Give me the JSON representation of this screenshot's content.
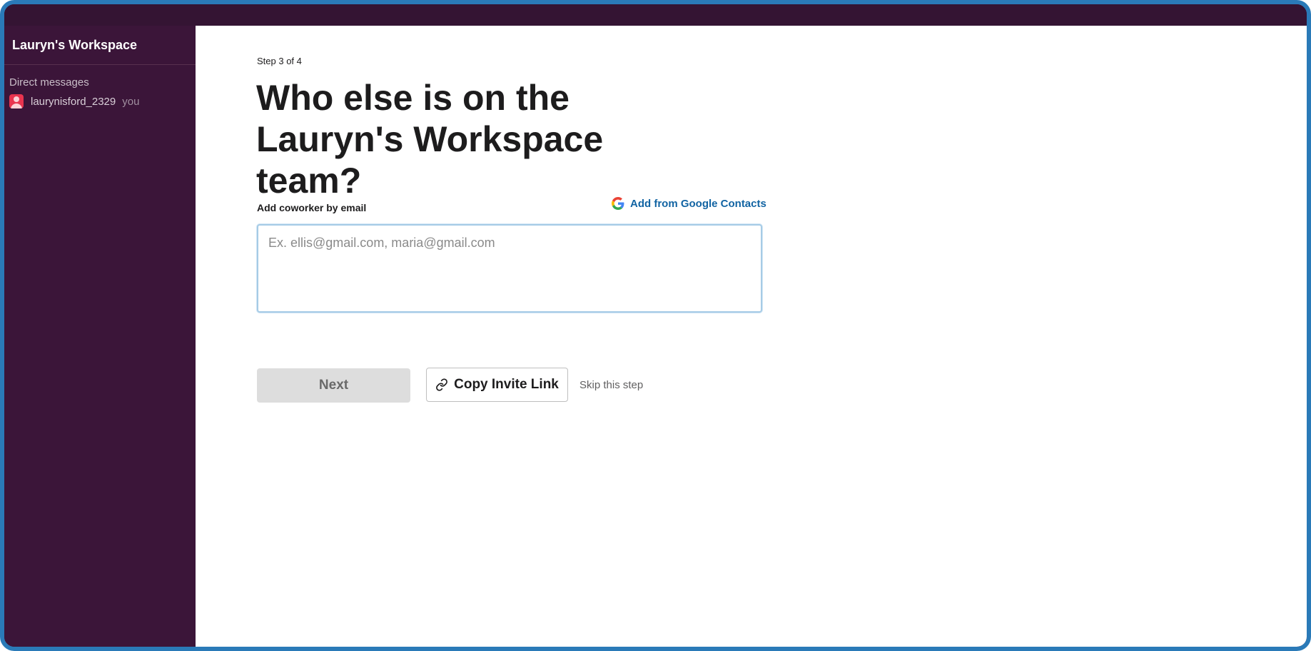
{
  "sidebar": {
    "workspace_name": "Lauryn's Workspace",
    "section_title": "Direct messages",
    "dm": {
      "name": "laurynisford_2329",
      "suffix": "you",
      "avatar_color": "#e8344f"
    }
  },
  "main": {
    "step": "Step 3 of 4",
    "heading": "Who else is on the Lauryn's Workspace team?",
    "field_label": "Add coworker by email",
    "google_link": "Add from Google Contacts",
    "email_placeholder": "Ex. ellis@gmail.com, maria@gmail.com",
    "email_value": "",
    "next_label": "Next",
    "copy_link_label": "Copy Invite Link",
    "skip_label": "Skip this step"
  },
  "colors": {
    "sidebar_bg": "#3b1539",
    "link": "#1264a3",
    "frame_border": "#2a7ab8"
  },
  "icons": {
    "google": "google-icon",
    "link": "link-icon",
    "avatar": "user-avatar-icon"
  }
}
